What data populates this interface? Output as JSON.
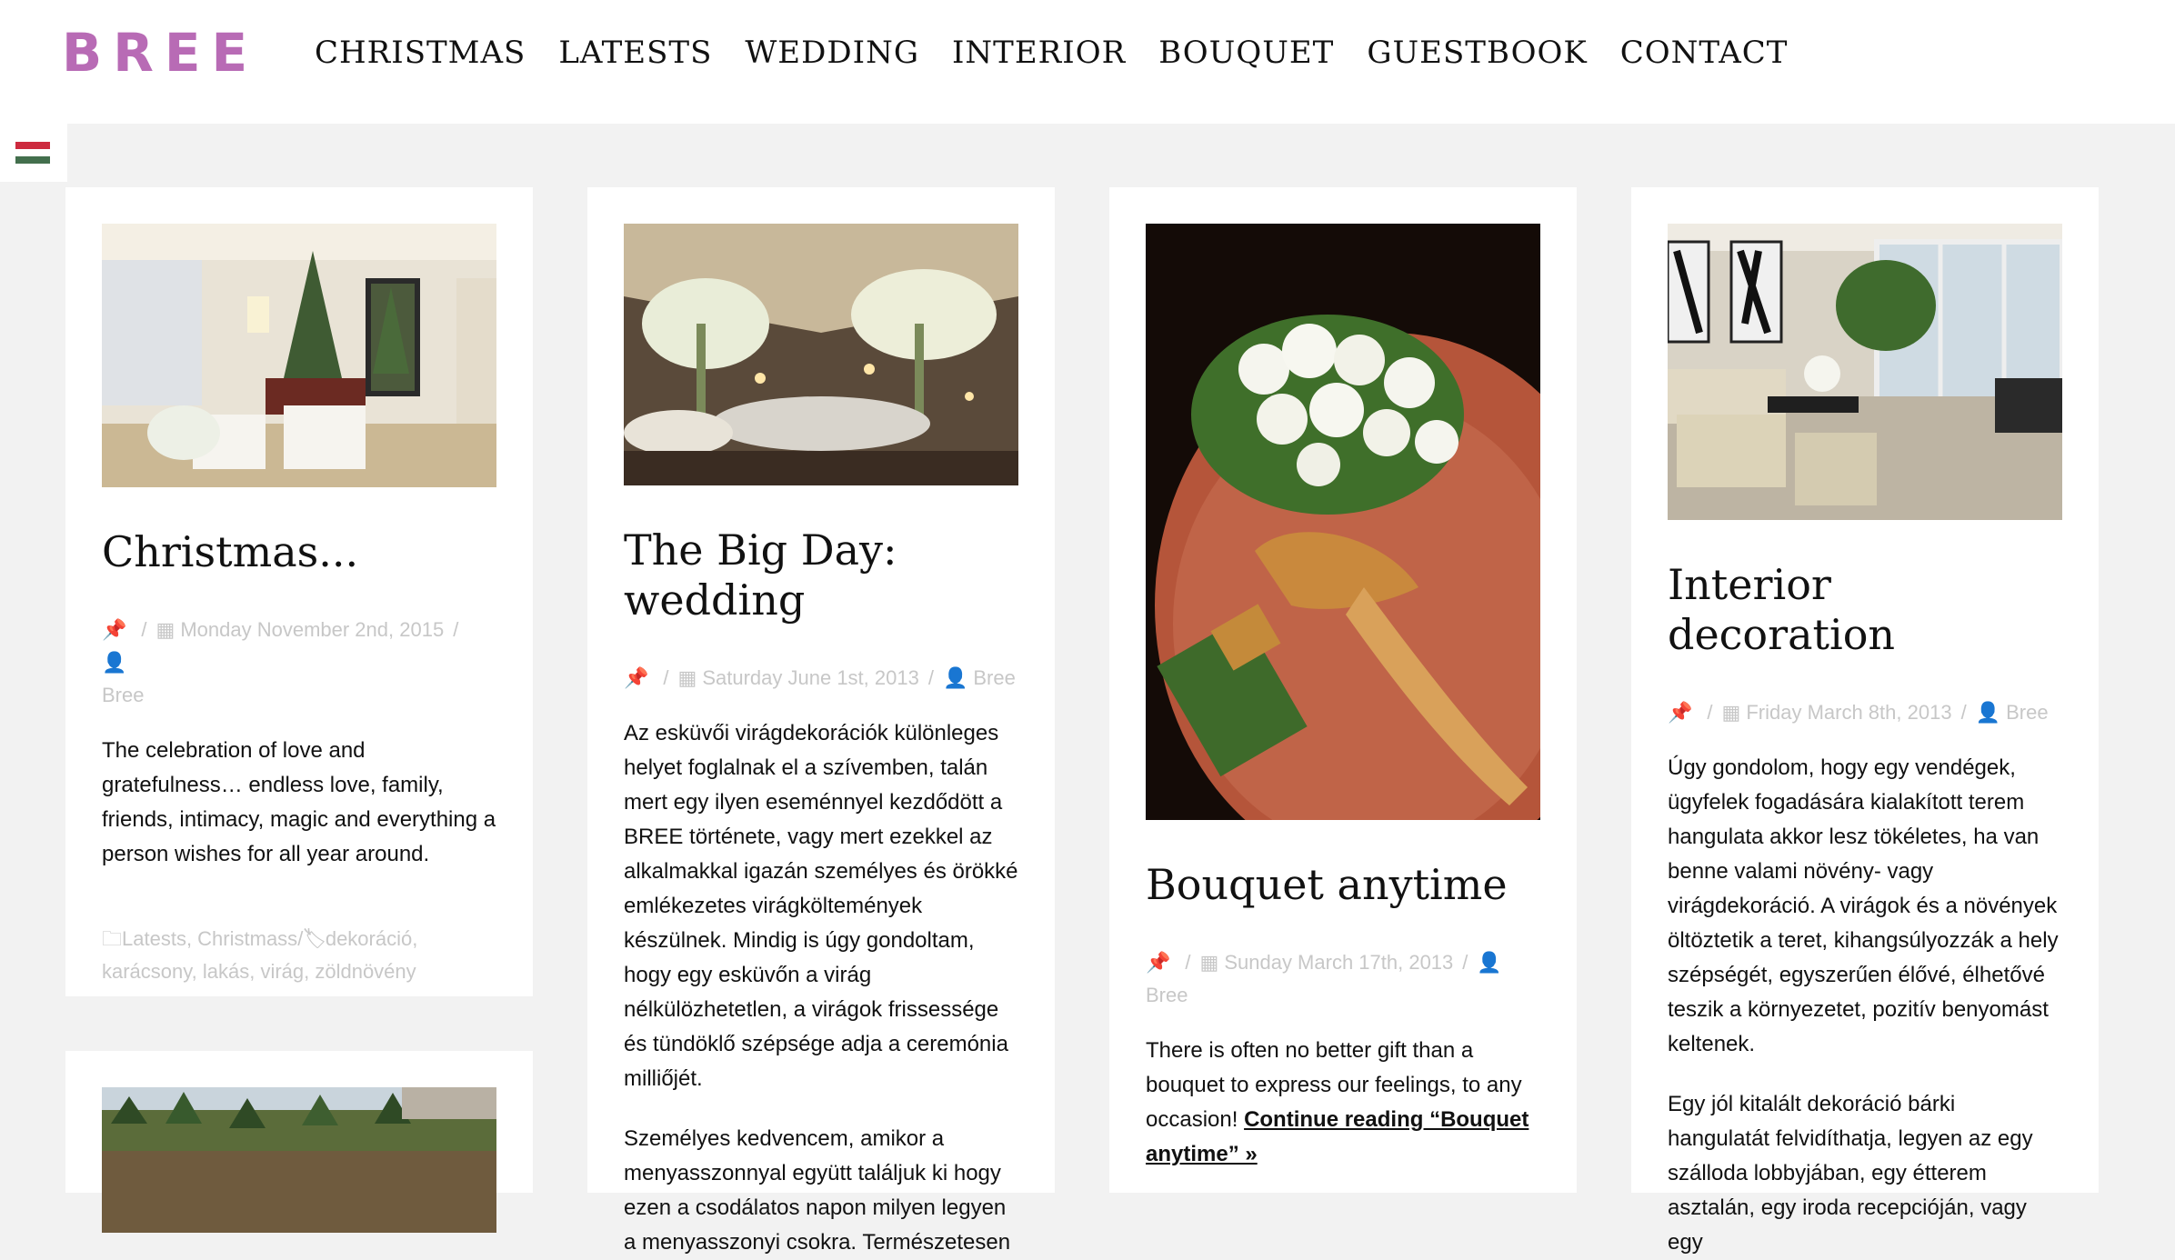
{
  "site": {
    "logo": "BREE",
    "logo_color": "#b86bb5"
  },
  "nav": [
    "CHRISTMAS",
    "LATESTS",
    "WEDDING",
    "INTERIOR",
    "BOUQUET",
    "GUESTBOOK",
    "CONTACT"
  ],
  "flag": {
    "icon": "hungarian-flag-icon",
    "colors": [
      "#cd2a3e",
      "#ffffff",
      "#436f4d"
    ]
  },
  "posts": [
    {
      "title": "Christmas...",
      "date": "Monday November 2nd, 2015",
      "author": "Bree",
      "excerpt": [
        "The celebration of love and gratefulness… endless love, family, friends, intimacy, magic and everything a person wishes for all year around."
      ],
      "categories": "Latests, Christmass",
      "tags": "dekoráció, karácsony, lakás, virág, zöldnövény"
    },
    {
      "title": "The Big Day: wedding",
      "date": "Saturday June 1st, 2013",
      "author": "Bree",
      "excerpt": [
        "Az esküvői virágdekorációk különleges helyet foglalnak el a szívemben, talán mert egy ilyen eseménnyel kezdődött a BREE története, vagy mert ezekkel az alkalmakkal igazán személyes és örökké emlékezetes virágköltemények készülnek. Mindig is úgy gondoltam, hogy egy esküvőn a virág nélkülözhetetlen, a virágok frissessége és tündöklő szépsége adja a ceremónia milliőjét.",
        "Személyes kedvencem, amikor a menyasszonnyal együtt találjuk ki hogy ezen a csodálatos napon milyen legyen a menyasszonyi csokra. Természetesen"
      ]
    },
    {
      "title": "Bouquet anytime",
      "date": "Sunday March 17th, 2013",
      "author": "Bree",
      "excerpt": "There is often no better gift than a bouquet to express our feelings, to any occasion!",
      "read_more": "Continue reading “Bouquet anytime” »"
    },
    {
      "title": "Interior decoration",
      "date": "Friday March 8th, 2013",
      "author": "Bree",
      "excerpt": [
        "Úgy gondolom, hogy egy vendégek, ügyfelek fogadására kialakított terem hangulata akkor lesz tökéletes, ha van benne valami növény- vagy virágdekoráció. A virágok és a növények öltöztetik a teret, kihangsúlyozzák a hely szépségét, egyszerűen élővé, élhetővé teszik a környezetet, pozitív benyomást keltenek.",
        "Egy jól kitalált dekoráció bárki hangulatát felvidíthatja, legyen az egy szálloda lobbyjában, egy étterem asztalán, egy iroda recepcióján, vagy egy"
      ]
    }
  ]
}
